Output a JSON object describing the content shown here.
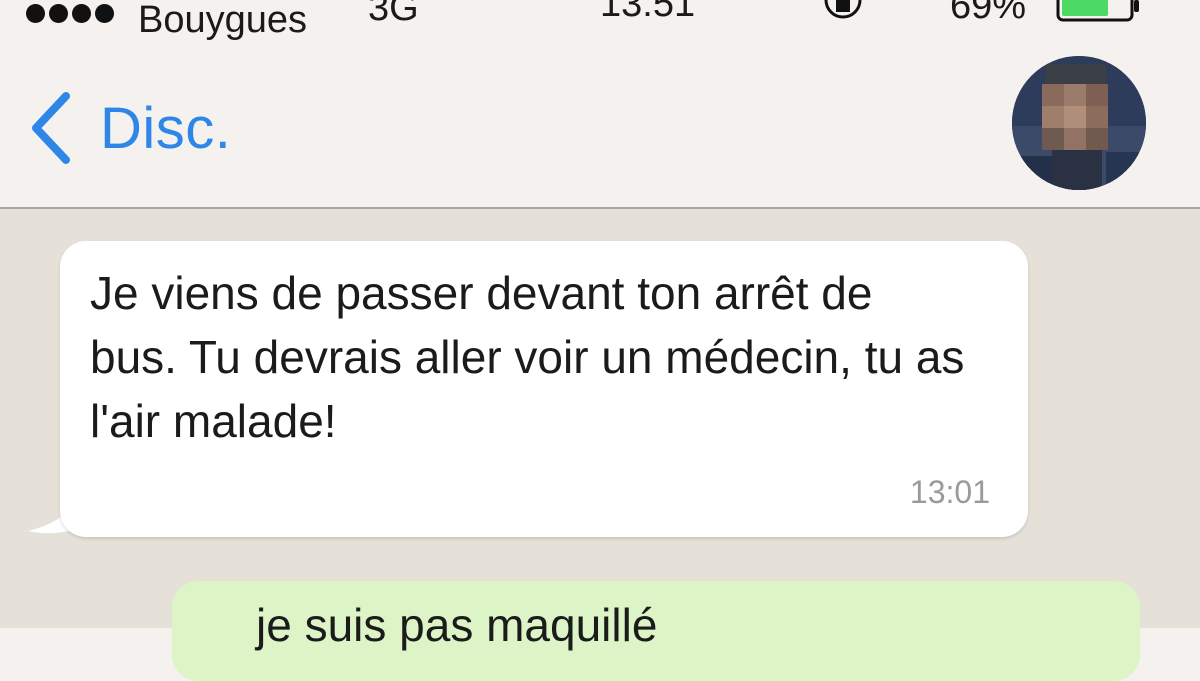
{
  "status_bar": {
    "carrier": "Bouygues",
    "network": "3G",
    "time": "13:51",
    "battery_percent": "69%",
    "battery_level": 0.69,
    "signal_dots": 4
  },
  "nav": {
    "back_label": "Disc."
  },
  "messages": [
    {
      "direction": "incoming",
      "text": "Je viens de passer devant ton arrêt de bus. Tu devrais aller voir un médecin, tu as l'air malade!",
      "time": "13:01"
    },
    {
      "direction": "outgoing",
      "text": "je suis pas maquillé"
    }
  ],
  "colors": {
    "accent": "#2e86e6",
    "battery": "#4cd964",
    "outgoing_bubble": "#dcf4c6"
  }
}
